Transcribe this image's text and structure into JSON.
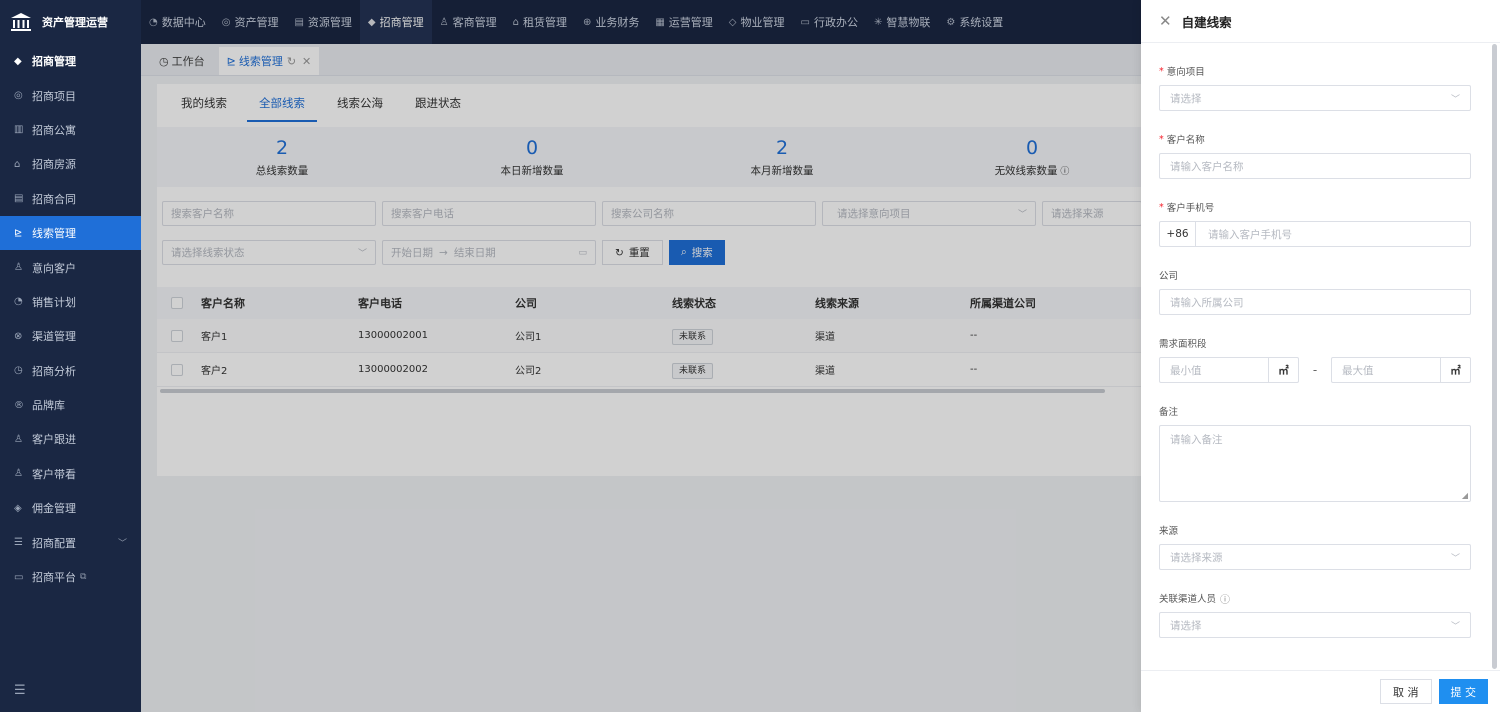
{
  "app": {
    "brand": "资产管理运营"
  },
  "topnav": [
    {
      "icon": "◔",
      "label": "数据中心"
    },
    {
      "icon": "◎",
      "label": "资产管理"
    },
    {
      "icon": "▤",
      "label": "资源管理"
    },
    {
      "icon": "◆",
      "label": "招商管理",
      "active": true
    },
    {
      "icon": "♙",
      "label": "客商管理"
    },
    {
      "icon": "⌂",
      "label": "租赁管理"
    },
    {
      "icon": "⊕",
      "label": "业务财务"
    },
    {
      "icon": "▦",
      "label": "运营管理"
    },
    {
      "icon": "◇",
      "label": "物业管理"
    },
    {
      "icon": "▭",
      "label": "行政办公"
    },
    {
      "icon": "✳",
      "label": "智慧物联"
    },
    {
      "icon": "⚙",
      "label": "系统设置"
    }
  ],
  "sidebar": {
    "header": "招商管理",
    "items": [
      {
        "icon": "◎",
        "label": "招商项目"
      },
      {
        "icon": "▥",
        "label": "招商公寓"
      },
      {
        "icon": "⌂",
        "label": "招商房源"
      },
      {
        "icon": "▤",
        "label": "招商合同"
      },
      {
        "icon": "⊵",
        "label": "线索管理",
        "active": true
      },
      {
        "icon": "♙",
        "label": "意向客户"
      },
      {
        "icon": "◔",
        "label": "销售计划"
      },
      {
        "icon": "⊗",
        "label": "渠道管理"
      },
      {
        "icon": "◷",
        "label": "招商分析"
      },
      {
        "icon": "®",
        "label": "品牌库"
      },
      {
        "icon": "♙",
        "label": "客户跟进"
      },
      {
        "icon": "♙",
        "label": "客户带看"
      },
      {
        "icon": "◈",
        "label": "佣金管理"
      },
      {
        "icon": "☰",
        "label": "招商配置",
        "chevron": "﹀"
      },
      {
        "icon": "▭",
        "label": "招商平台",
        "ext": "⧉"
      }
    ],
    "collapse_icon": "☰"
  },
  "tabs": [
    {
      "icon": "◷",
      "label": "工作台"
    },
    {
      "icon": "⊵",
      "label": "线索管理",
      "active": true
    }
  ],
  "subtabs": [
    "我的线索",
    "全部线索",
    "线索公海",
    "跟进状态"
  ],
  "stats": [
    {
      "value": "2",
      "label": "总线索数量"
    },
    {
      "value": "0",
      "label": "本日新增数量"
    },
    {
      "value": "2",
      "label": "本月新增数量"
    },
    {
      "value": "0",
      "label": "无效线索数量"
    }
  ],
  "filters": {
    "customer_name": "搜索客户名称",
    "customer_phone": "搜索客户电话",
    "company_name": "搜索公司名称",
    "project": "请选择意向项目",
    "source": "请选择来源",
    "status": "请选择线索状态",
    "start_date": "开始日期",
    "end_date": "结束日期",
    "date_arrow": "→",
    "reset": "重置",
    "search": "搜索"
  },
  "table": {
    "columns": [
      "客户名称",
      "客户电话",
      "公司",
      "线索状态",
      "线索来源",
      "所属渠道公司"
    ],
    "rows": [
      {
        "name": "客户1",
        "phone": "13000002001",
        "company": "公司1",
        "status": "未联系",
        "source": "渠道",
        "channel": "--"
      },
      {
        "name": "客户2",
        "phone": "13000002002",
        "company": "公司2",
        "status": "未联系",
        "source": "渠道",
        "channel": "--"
      }
    ]
  },
  "drawer": {
    "title": "自建线索",
    "fields": {
      "project": {
        "label": "意向项目",
        "placeholder": "请选择"
      },
      "customer_name": {
        "label": "客户名称",
        "placeholder": "请输入客户名称"
      },
      "customer_phone": {
        "label": "客户手机号",
        "prefix": "+86",
        "placeholder": "请输入客户手机号"
      },
      "company": {
        "label": "公司",
        "placeholder": "请输入所属公司"
      },
      "area": {
        "label": "需求面积段",
        "min_placeholder": "最小值",
        "max_placeholder": "最大值",
        "unit": "㎡",
        "separator": "-"
      },
      "remark": {
        "label": "备注",
        "placeholder": "请输入备注"
      },
      "source": {
        "label": "来源",
        "placeholder": "请选择来源"
      },
      "channel_person": {
        "label": "关联渠道人员",
        "placeholder": "请选择"
      }
    },
    "cancel": "取 消",
    "submit": "提 交"
  },
  "colors": {
    "nav_bg": "#1a2743",
    "primary": "#1f6fd8",
    "submit": "#1f8ff0",
    "required": "#f5222d"
  }
}
